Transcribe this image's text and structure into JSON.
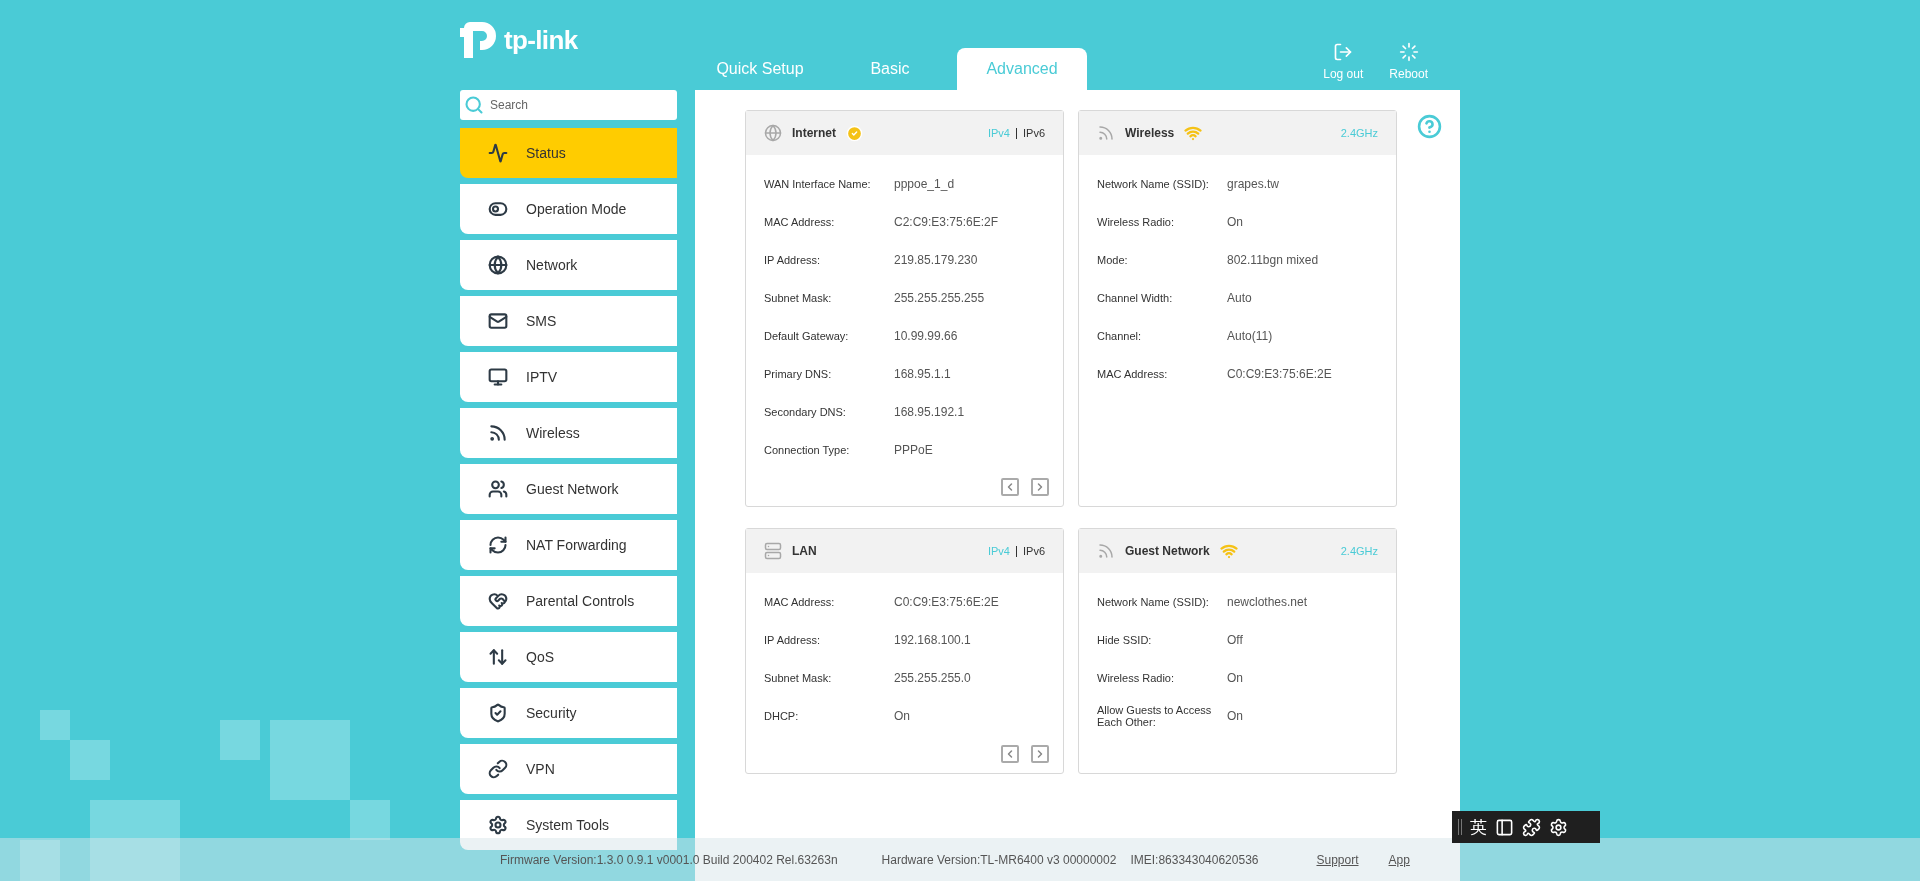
{
  "logo": {
    "text": "tp-link"
  },
  "tabs": [
    {
      "label": "Quick Setup",
      "selected": false
    },
    {
      "label": "Basic",
      "selected": false
    },
    {
      "label": "Advanced",
      "selected": true
    }
  ],
  "header_actions": [
    {
      "kind": "logout",
      "label": "Log out"
    },
    {
      "kind": "reboot",
      "label": "Reboot"
    }
  ],
  "search": {
    "placeholder": "Search"
  },
  "sidebar": {
    "items": [
      {
        "label": "Status",
        "selected": true
      },
      {
        "label": "Operation Mode",
        "selected": false
      },
      {
        "label": "Network",
        "selected": false
      },
      {
        "label": "SMS",
        "selected": false
      },
      {
        "label": "IPTV",
        "selected": false
      },
      {
        "label": "Wireless",
        "selected": false
      },
      {
        "label": "Guest Network",
        "selected": false
      },
      {
        "label": "NAT Forwarding",
        "selected": false
      },
      {
        "label": "Parental Controls",
        "selected": false
      },
      {
        "label": "QoS",
        "selected": false
      },
      {
        "label": "Security",
        "selected": false
      },
      {
        "label": "VPN",
        "selected": false
      },
      {
        "label": "System Tools",
        "selected": false
      }
    ]
  },
  "cards": [
    {
      "kind": "internet",
      "title": "Internet",
      "connected": true,
      "ip_versions": [
        {
          "label": "IPv4",
          "selected": true
        },
        {
          "label": "IPv6",
          "selected": false
        }
      ],
      "pager": true,
      "rows": [
        {
          "label": "WAN Interface Name:",
          "value": "pppoe_1_d"
        },
        {
          "label": "MAC Address:",
          "value": "C2:C9:E3:75:6E:2F"
        },
        {
          "label": "IP Address:",
          "value": "219.85.179.230"
        },
        {
          "label": "Subnet Mask:",
          "value": "255.255.255.255"
        },
        {
          "label": "Default Gateway:",
          "value": "10.99.99.66"
        },
        {
          "label": "Primary DNS:",
          "value": "168.95.1.1"
        },
        {
          "label": "Secondary DNS:",
          "value": "168.95.192.1"
        },
        {
          "label": "Connection Type:",
          "value": "PPPoE"
        }
      ]
    },
    {
      "kind": "wireless",
      "title": "Wireless",
      "band": "2.4GHz",
      "pager": false,
      "rows": [
        {
          "label": "Network Name (SSID):",
          "value": "grapes.tw"
        },
        {
          "label": "Wireless Radio:",
          "value": "On"
        },
        {
          "label": "Mode:",
          "value": "802.11bgn mixed"
        },
        {
          "label": "Channel Width:",
          "value": "Auto"
        },
        {
          "label": "Channel:",
          "value": "Auto(11)"
        },
        {
          "label": "MAC Address:",
          "value": "C0:C9:E3:75:6E:2E"
        }
      ]
    },
    {
      "kind": "lan",
      "title": "LAN",
      "ip_versions": [
        {
          "label": "IPv4",
          "selected": true
        },
        {
          "label": "IPv6",
          "selected": false
        }
      ],
      "pager": true,
      "rows": [
        {
          "label": "MAC Address:",
          "value": "C0:C9:E3:75:6E:2E"
        },
        {
          "label": "IP Address:",
          "value": "192.168.100.1"
        },
        {
          "label": "Subnet Mask:",
          "value": "255.255.255.0"
        },
        {
          "label": "DHCP:",
          "value": "On"
        }
      ]
    },
    {
      "kind": "wireless",
      "title": "Guest Network",
      "band": "2.4GHz",
      "pager": false,
      "rows": [
        {
          "label": "Network Name (SSID):",
          "value": "newclothes.net"
        },
        {
          "label": "Hide SSID:",
          "value": "Off"
        },
        {
          "label": "Wireless Radio:",
          "value": "On"
        },
        {
          "label": "Allow Guests to Access Each Other:",
          "value": "On"
        }
      ]
    }
  ],
  "footer": {
    "firmware": "Firmware Version:1.3.0 0.9.1 v0001.0 Build 200402 Rel.63263n",
    "hardware": "Hardware Version:TL-MR6400 v3 00000002",
    "imei": "IMEI:863343040620536",
    "links": [
      "Support",
      "App"
    ]
  },
  "ime_toolbar": {
    "language": "英"
  }
}
